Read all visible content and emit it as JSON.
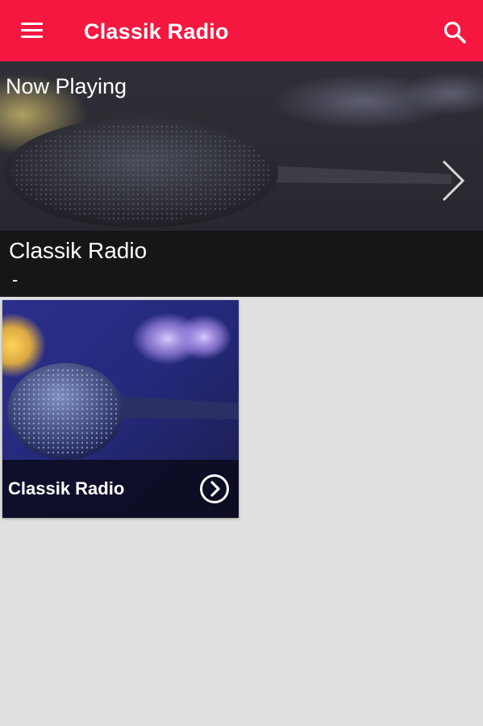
{
  "header": {
    "title": "Classik Radio",
    "menu_icon": "hamburger-menu-icon",
    "search_icon": "search-icon",
    "background": "#f5173f"
  },
  "now_playing": {
    "heading": "Now Playing",
    "station": "Classik Radio",
    "track": "-",
    "next_icon": "chevron-right-icon"
  },
  "stations": [
    {
      "label": "Classik Radio",
      "icon": "arrow-circle-right-icon"
    }
  ]
}
